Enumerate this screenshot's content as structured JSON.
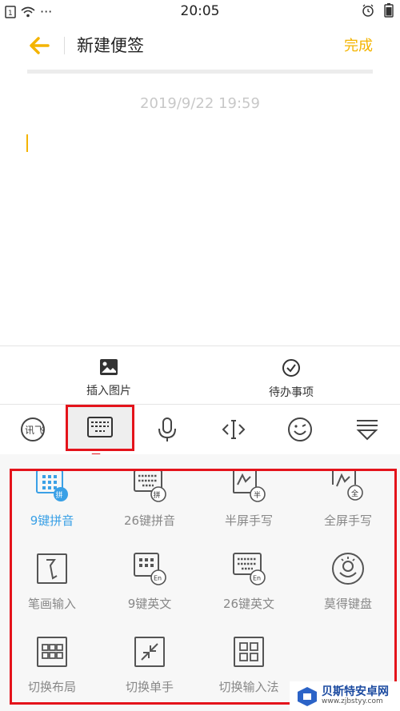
{
  "status": {
    "time": "20:05",
    "dots": "···"
  },
  "header": {
    "title": "新建便签",
    "done_label": "完成"
  },
  "note": {
    "date": "2019/9/22 19:59"
  },
  "tools": [
    {
      "label": "插入图片",
      "icon": "image-icon"
    },
    {
      "label": "待办事项",
      "icon": "checkmark-circle-icon"
    }
  ],
  "keyboard_toolbar": [
    "logo-icon",
    "keyboard-icon",
    "microphone-icon",
    "cursor-move-icon",
    "emoji-icon",
    "collapse-icon"
  ],
  "panel": {
    "items": [
      {
        "label": "9键拼音",
        "active": true,
        "icon": "keypad-9-pinyin-icon",
        "badge": "拼"
      },
      {
        "label": "26键拼音",
        "active": false,
        "icon": "keypad-26-pinyin-icon",
        "badge": "拼"
      },
      {
        "label": "半屏手写",
        "active": false,
        "icon": "half-handwrite-icon",
        "badge": "半"
      },
      {
        "label": "全屏手写",
        "active": false,
        "icon": "full-handwrite-icon",
        "badge": "全"
      },
      {
        "label": "笔画输入",
        "active": false,
        "icon": "stroke-input-icon"
      },
      {
        "label": "9键英文",
        "active": false,
        "icon": "keypad-9-english-icon",
        "badge": "En"
      },
      {
        "label": "26键英文",
        "active": false,
        "icon": "keypad-26-english-icon",
        "badge": "En"
      },
      {
        "label": "莫得键盘",
        "active": false,
        "icon": "mode-keyboard-icon"
      },
      {
        "label": "切换布局",
        "active": false,
        "icon": "layout-icon"
      },
      {
        "label": "切换单手",
        "active": false,
        "icon": "one-hand-icon"
      },
      {
        "label": "切换输入法",
        "active": false,
        "icon": "switch-ime-icon"
      }
    ]
  },
  "watermark": {
    "title": "贝斯特安卓网",
    "url": "www.zjbstyy.com"
  }
}
